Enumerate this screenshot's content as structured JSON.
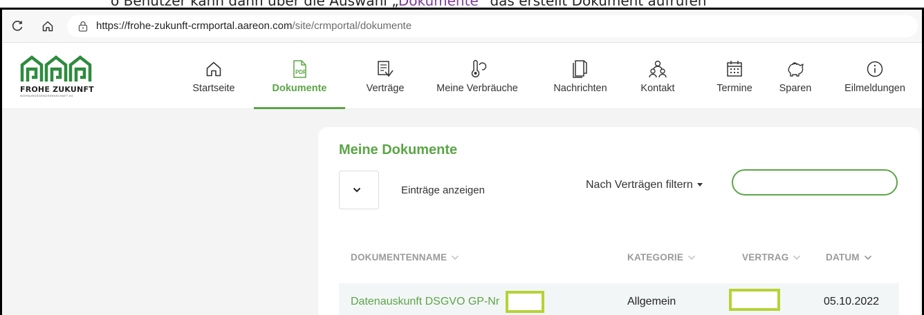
{
  "caption": {
    "text_before": "o    Benutzer kann dann über die Auswahl „",
    "accent": "Dokumente",
    "text_after": "“ das erstellt Dokument aufrufen"
  },
  "browser": {
    "url_host": "https://frohe-zukunft-crmportal.aareon.com",
    "url_path": "/site/crmportal/dokumente"
  },
  "logo": {
    "brand": "FROHE ZUKUNFT",
    "sub": "WOHNUNGSGENOSSENSCHAFT eG"
  },
  "nav": {
    "items": [
      {
        "label": "Startseite",
        "icon": "home-icon"
      },
      {
        "label": "Dokumente",
        "icon": "pdf-document-icon"
      },
      {
        "label": "Verträge",
        "icon": "contract-icon"
      },
      {
        "label": "Meine Verbräuche",
        "icon": "thermometer-icon"
      },
      {
        "label": "Nachrichten",
        "icon": "messages-icon"
      },
      {
        "label": "Kontakt",
        "icon": "contact-people-icon"
      },
      {
        "label": "Termine",
        "icon": "calendar-icon"
      },
      {
        "label": "Sparen",
        "icon": "piggy-bank-icon"
      },
      {
        "label": "Eilmeldungen",
        "icon": "info-icon"
      }
    ],
    "active": "Dokumente"
  },
  "documents": {
    "title": "Meine Dokumente",
    "entries_label": "Einträge anzeigen",
    "filter_label": "Nach Verträgen filtern",
    "search_value": "",
    "columns": [
      "DOKUMENTENNAME",
      "KATEGORIE",
      "VERTRAG",
      "DATUM"
    ],
    "rows": [
      {
        "name": "Datenauskunft DSGVO GP-Nr",
        "category": "Allgemein",
        "contract": "",
        "date": "05.10.2022"
      }
    ]
  },
  "colors": {
    "accent_green": "#5ba547",
    "redaction_highlight": "#b5d334"
  }
}
